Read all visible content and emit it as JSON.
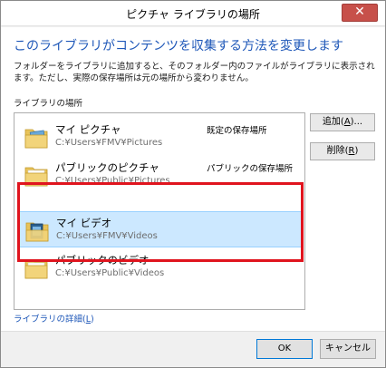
{
  "window": {
    "title": "ピクチャ ライブラリの場所",
    "close_glyph": "✕"
  },
  "heading": "このライブラリがコンテンツを収集する方法を変更します",
  "description": "フォルダーをライブラリに追加すると、そのフォルダー内のファイルがライブラリに表示されます。ただし、実際の保存場所は元の場所から変わりません。",
  "section_label": "ライブラリの場所",
  "locations": [
    {
      "name": "マイ ピクチャ",
      "path": "C:¥Users¥FMV¥Pictures",
      "status": "既定の保存場所",
      "icon": "pictures-folder-icon",
      "selected": false
    },
    {
      "name": "パブリックのピクチャ",
      "path": "C:¥Users¥Public¥Pictures",
      "status": "パブリックの保存場所",
      "icon": "folder-icon",
      "selected": false
    },
    {
      "name": "マイ ビデオ",
      "path": "C:¥Users¥FMV¥Videos",
      "status": "",
      "icon": "videos-folder-icon",
      "selected": true
    },
    {
      "name": "パブリックのビデオ",
      "path": "C:¥Users¥Public¥Videos",
      "status": "",
      "icon": "folder-icon",
      "selected": false
    }
  ],
  "buttons": {
    "add_prefix": "追加(",
    "add_key": "A",
    "add_suffix": ")...",
    "remove_prefix": "削除(",
    "remove_key": "R",
    "remove_suffix": ")",
    "ok": "OK",
    "cancel": "キャンセル"
  },
  "details_link": {
    "prefix": "ライブラリの詳細(",
    "key": "L",
    "suffix": ")"
  },
  "colors": {
    "accent": "#1e57b8",
    "selection": "#cce8ff",
    "annotation": "#e0141e"
  }
}
